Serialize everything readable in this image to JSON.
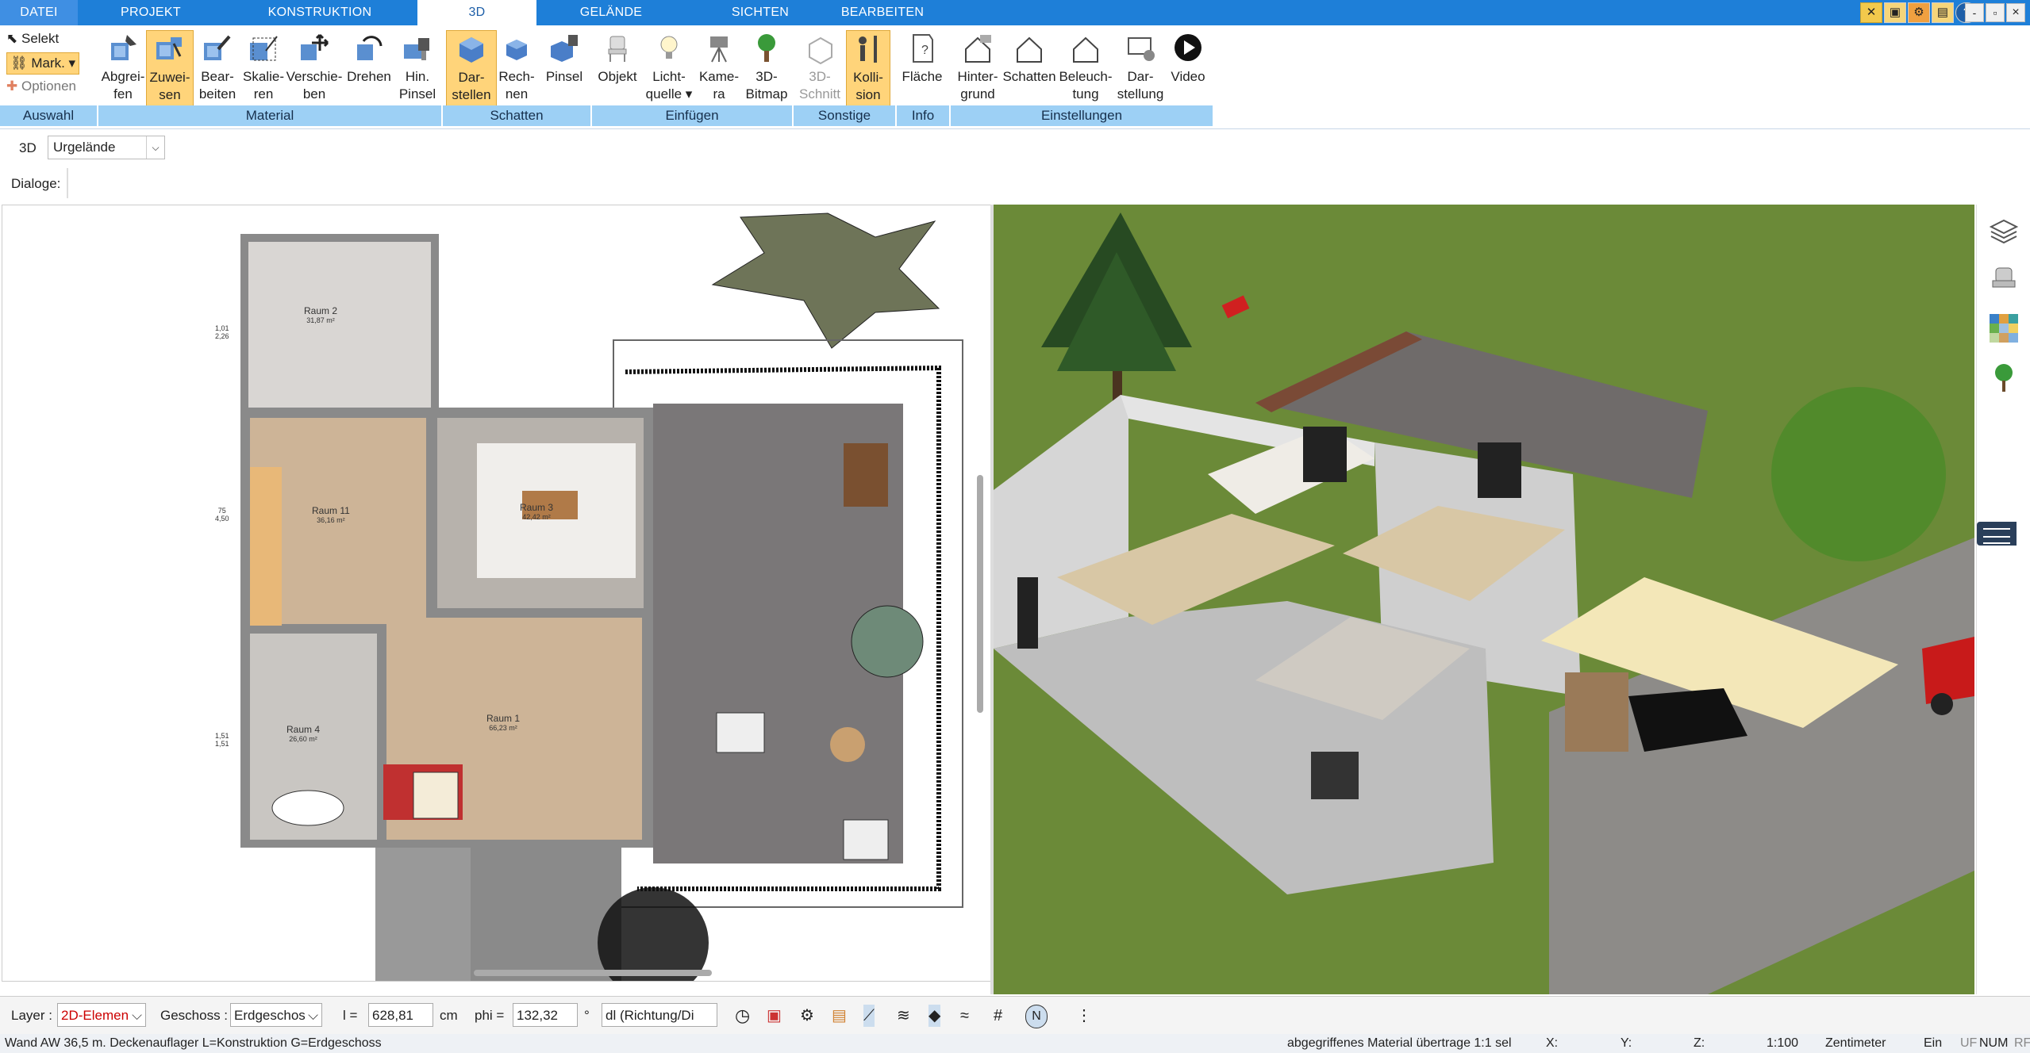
{
  "tabs": {
    "datei": "DATEI",
    "projekt": "PROJEKT",
    "konstruktion": "KONSTRUKTION",
    "dreid": "3D",
    "gelaende": "GELÄNDE",
    "sichten": "SICHTEN",
    "bearbeiten": "BEARBEITEN"
  },
  "window_controls": {
    "min": "-",
    "max": "▫",
    "close": "×"
  },
  "auswahl": {
    "selekt": "Selekt",
    "mark": "Mark.",
    "optionen": "Optionen",
    "group": "Auswahl"
  },
  "material": {
    "group": "Material",
    "abgreifen": [
      "Abgrei-",
      "fen"
    ],
    "zuweisen": [
      "Zuwei-",
      "sen"
    ],
    "bearbeiten": [
      "Bear-",
      "beiten"
    ],
    "skalieren": [
      "Skalie-",
      "ren"
    ],
    "verschieben": [
      "Verschie-",
      "ben"
    ],
    "drehen": [
      "Drehen",
      ""
    ],
    "hinpinsel": [
      "Hin.",
      "Pinsel"
    ]
  },
  "schatten": {
    "group": "Schatten",
    "darstellen": [
      "Dar-",
      "stellen"
    ],
    "rechnen": [
      "Rech-",
      "nen"
    ],
    "pinsel": [
      "Pinsel",
      ""
    ]
  },
  "einfuegen": {
    "group": "Einfügen",
    "objekt": [
      "Objekt",
      ""
    ],
    "lichtquelle": [
      "Licht-",
      "quelle"
    ],
    "kamera": [
      "Kame-",
      "ra"
    ],
    "bitmap": [
      "3D-",
      "Bitmap"
    ]
  },
  "sonstige": {
    "group": "Sonstige",
    "schnitt": [
      "3D-",
      "Schnitt"
    ],
    "kollision": [
      "Kolli-",
      "sion"
    ]
  },
  "info": {
    "group": "Info",
    "flaeche": [
      "Fläche",
      ""
    ]
  },
  "einstellungen": {
    "group": "Einstellungen",
    "hintergrund": [
      "Hinter-",
      "grund"
    ],
    "schatten": [
      "Schatten",
      ""
    ],
    "beleuchtung": [
      "Beleuch-",
      "tung"
    ],
    "darstellung": [
      "Dar-",
      "stellung"
    ],
    "video": [
      "Video",
      ""
    ]
  },
  "row3d": {
    "label": "3D",
    "select": "Urgelände"
  },
  "dialoge": {
    "label": "Dialoge:"
  },
  "plan": {
    "rooms": [
      {
        "name": "Raum 2",
        "area": "31,87 m²"
      },
      {
        "name": "Raum 11",
        "area": "36,16 m²"
      },
      {
        "name": "Raum 3",
        "area": "42,42 m²"
      },
      {
        "name": "Raum 1",
        "area": "66,23 m²"
      },
      {
        "name": "Raum 4",
        "area": "26,60 m²"
      }
    ],
    "dims": [
      "1,01",
      "2,26",
      "75",
      "4,50",
      "1,51",
      "1,51"
    ]
  },
  "bottom": {
    "layer_label": "Layer :",
    "layer_value": "2D-Elemen",
    "geschoss_label": "Geschoss :",
    "geschoss_value": "Erdgeschos",
    "l_label": "l =",
    "l_value": "628,81",
    "l_unit": "cm",
    "phi_label": "phi =",
    "phi_value": "132,32",
    "phi_unit": "°",
    "dl_value": "dl (Richtung/Di"
  },
  "status": {
    "left": "Wand AW 36,5 m. Deckenauflager L=Konstruktion G=Erdgeschoss",
    "material": "abgegriffenes Material übertrage 1:1 sel",
    "x": "X:",
    "y": "Y:",
    "z": "Z:",
    "scale": "1:100",
    "unit": "Zentimeter",
    "ein": "Ein",
    "uf": "UF",
    "num": "NUM",
    "rf": "RF"
  },
  "colors": {
    "accent": "#1e7fd8",
    "group": "#9dd0f5",
    "active_btn": "#ffd47a",
    "grass": "#6f8a3a"
  }
}
